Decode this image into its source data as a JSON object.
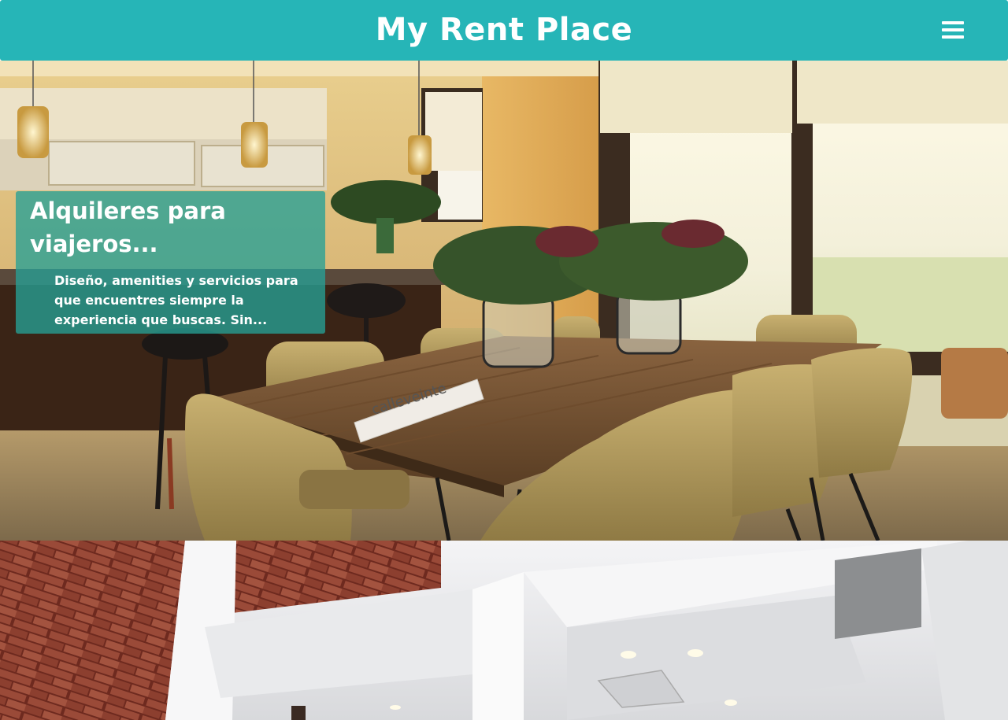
{
  "header": {
    "brand": "My Rent Place",
    "menu_icon": "hamburger-menu-icon",
    "background_color": "#26b5b7"
  },
  "hero": {
    "slides": [
      {
        "image": "dining-room-photo",
        "title": "Alquileres para viajeros...",
        "text": "Diseño, amenities y servicios para que encuentres siempre la experiencia que buscas. Sin...",
        "sign_text": "calleveinte"
      },
      {
        "image": "brick-loft-interior-photo"
      }
    ]
  }
}
